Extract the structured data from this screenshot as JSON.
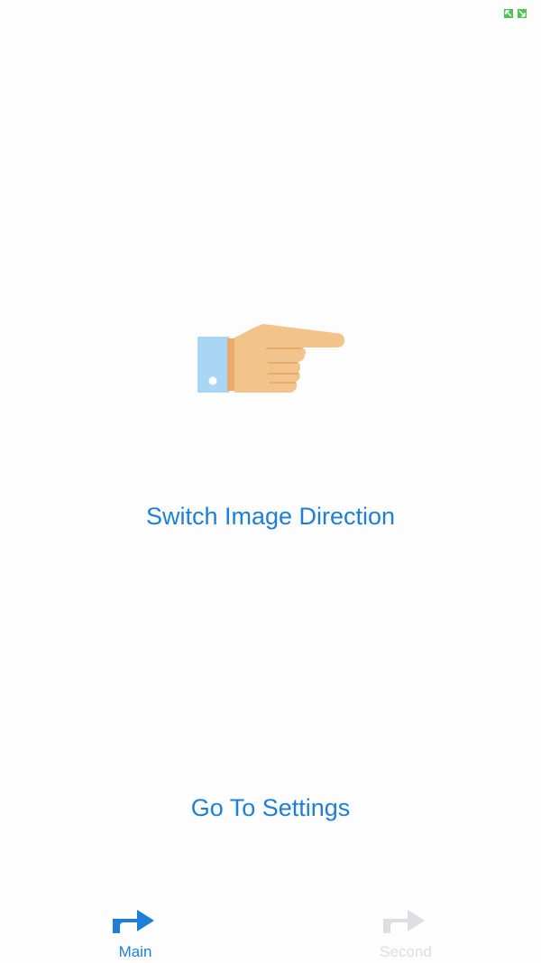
{
  "colors": {
    "accent": "#1f7fd6",
    "inactive_tab": "#dedee2",
    "hand_skin": "#f2c38b",
    "hand_shadow": "#e8ac6d",
    "cuff": "#a9d6f5",
    "status_green": "#52c255"
  },
  "status_bar": {
    "indicator_icon": "resize-handle-icon"
  },
  "main": {
    "image_icon": "pointing-hand-right-icon",
    "switch_direction_label": "Switch Image Direction",
    "go_to_settings_label": "Go To Settings"
  },
  "tab_bar": {
    "tabs": [
      {
        "label": "Main",
        "icon": "forward-arrow-icon",
        "selected": true
      },
      {
        "label": "Second",
        "icon": "forward-arrow-icon",
        "selected": false
      }
    ]
  }
}
